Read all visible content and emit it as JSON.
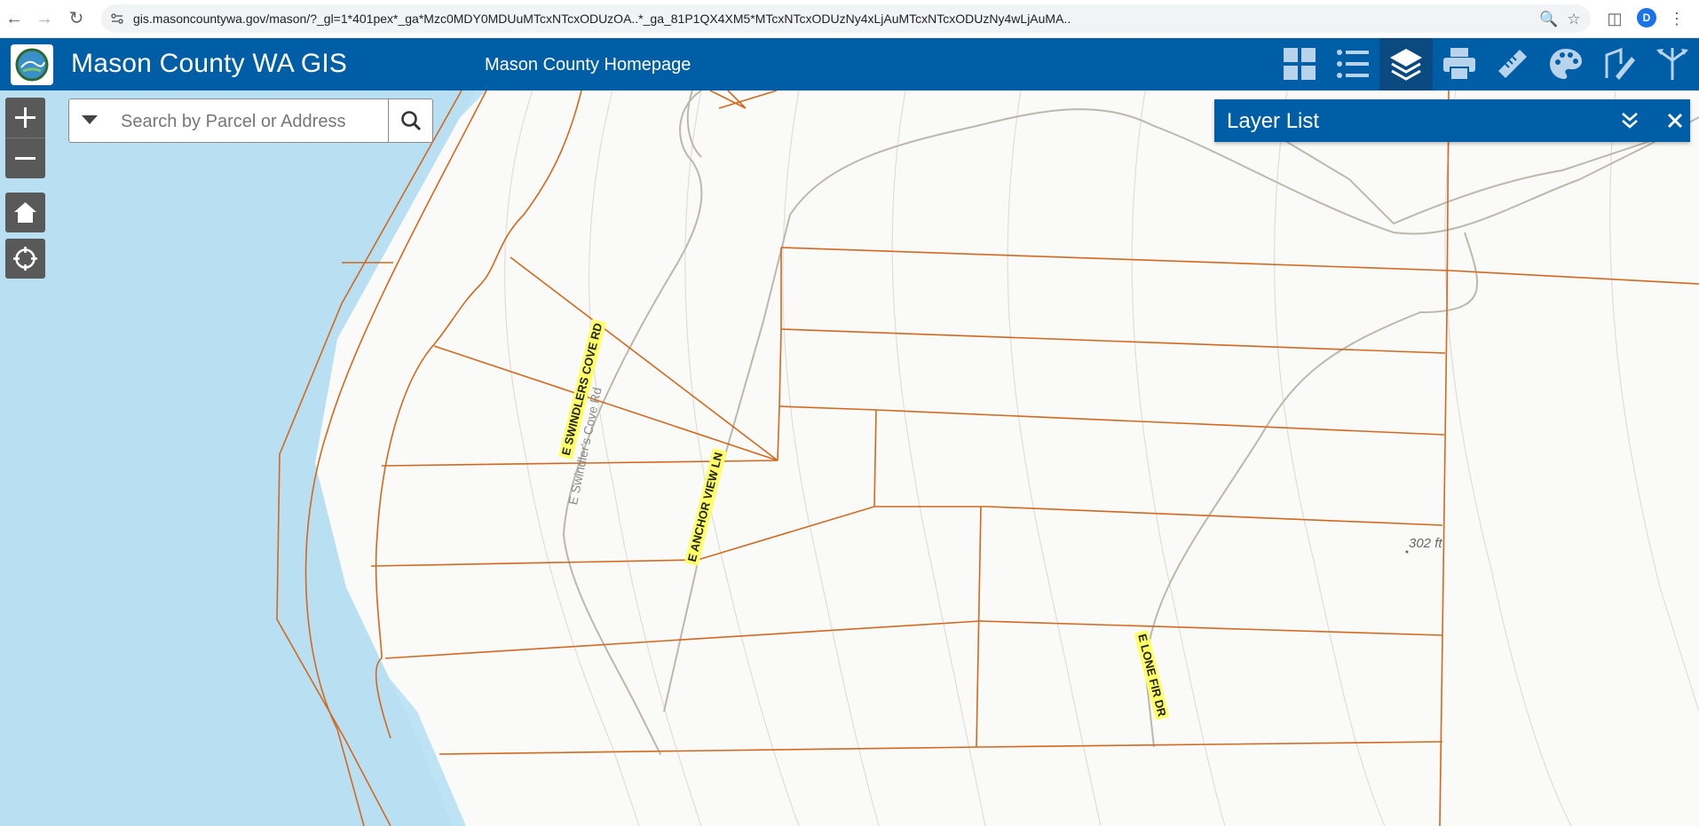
{
  "browser": {
    "url": "gis.masoncountywa.gov/mason/?_gl=1*401pex*_ga*Mzc0MDY0MDUuMTcxNTcxODUzOA..*_ga_81P1QX4XM5*MTcxNTcxODUzNy4xLjAuMTcxNTcxODUzNy4wLjAuMA..",
    "profile_initial": "D"
  },
  "header": {
    "title": "Mason County WA GIS",
    "home_link": "Mason County Homepage",
    "widgets": [
      "grid-icon",
      "list-icon",
      "layers-icon",
      "print-icon",
      "measure-icon",
      "palette-icon",
      "draw-icon",
      "share-icon"
    ],
    "active_widget": "layers-icon",
    "color": "#005ea6"
  },
  "search": {
    "placeholder": "Search by Parcel or Address"
  },
  "panel": {
    "title": "Layer List"
  },
  "map": {
    "road_labels": [
      "E SWINDLERS COVE RD",
      "E ANCHOR VIEW LN",
      "E LONE FIR DR"
    ],
    "ghost_label": "E Swindler's Cove Rd",
    "elevation_label": "302 ft",
    "water_color": "#bde3f4",
    "parcel_line_color": "#d2691e"
  }
}
